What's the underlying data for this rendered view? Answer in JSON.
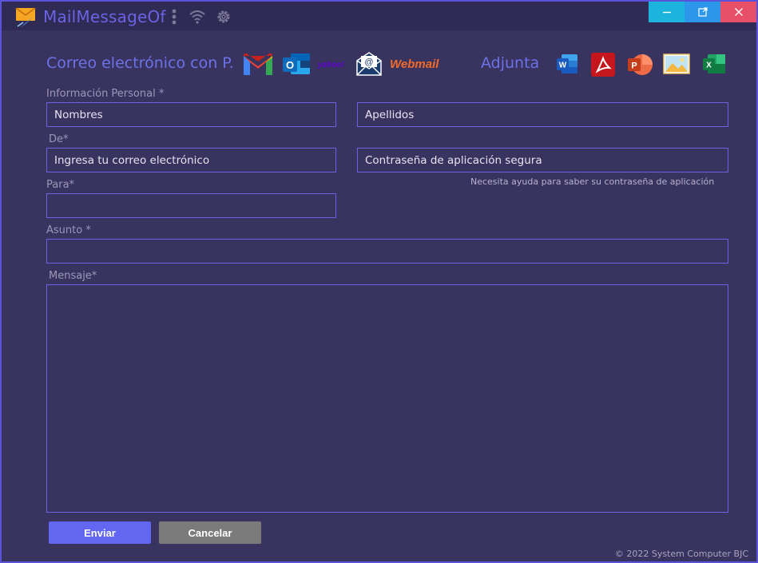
{
  "window": {
    "title": "MailMessageOf",
    "controls": [
      "minimize-icon",
      "popout-icon",
      "close-icon"
    ]
  },
  "toolbar_icons": [
    "more-vertical-icon",
    "wifi-icon",
    "gear-icon"
  ],
  "header": {
    "providers_heading": "Correo electrónico con P.",
    "providers": [
      {
        "name": "gmail-icon",
        "text": "M"
      },
      {
        "name": "outlook-icon",
        "text": "O"
      },
      {
        "name": "yahoo-icon",
        "text": "yahoo!"
      },
      {
        "name": "mail-envelope-icon",
        "text": "@"
      },
      {
        "name": "webmail-logo",
        "text": "Webmail"
      }
    ],
    "attach_heading": "Adjunta",
    "attachments": [
      {
        "name": "word-icon",
        "text": "W"
      },
      {
        "name": "pdf-icon",
        "text": "A"
      },
      {
        "name": "powerpoint-icon",
        "text": "P"
      },
      {
        "name": "image-icon",
        "text": ""
      },
      {
        "name": "excel-icon",
        "text": "X"
      }
    ]
  },
  "form": {
    "personal_label": "Información Personal *",
    "first_name_placeholder": "Nombres",
    "last_name_placeholder": "Apellidos",
    "from_label": "De*",
    "email_placeholder": "Ingresa tu correo electrónico",
    "app_password_placeholder": "Contraseña de aplicación segura",
    "password_hint": "Necesita ayuda para saber su contraseña de aplicación",
    "to_label": "Para*",
    "to_value": "",
    "subject_label": "Asunto *",
    "subject_value": "",
    "message_label": "Mensaje*",
    "message_value": ""
  },
  "buttons": {
    "send": "Enviar",
    "cancel": "Cancelar"
  },
  "footer": "© 2022 System Computer BJC",
  "colors": {
    "background": "#38335f",
    "titlebar": "#302b54",
    "accent": "#6366f1",
    "field_border": "#6a62e0",
    "close": "#e85068",
    "minimize": "#1cb3dd",
    "maximize": "#2c96ea"
  }
}
